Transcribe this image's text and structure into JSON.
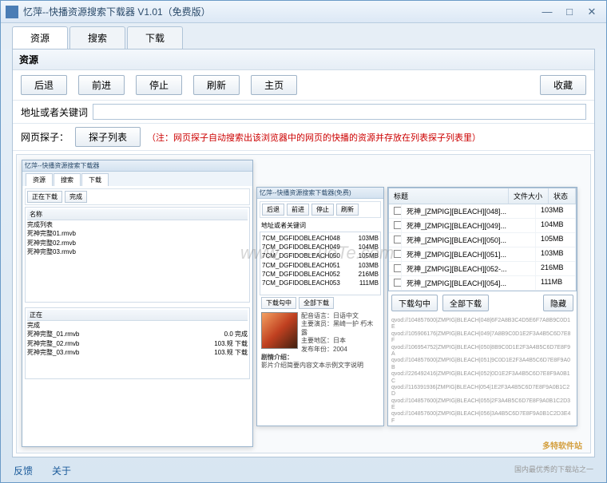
{
  "window": {
    "title": "忆萍--快播资源搜索下载器  V1.01（免费版）"
  },
  "tabs": {
    "resource": "资源",
    "search": "搜索",
    "download": "下载"
  },
  "section": {
    "title": "资源"
  },
  "toolbar": {
    "back": "后退",
    "forward": "前进",
    "stop": "停止",
    "refresh": "刷新",
    "home": "主页",
    "favorites": "收藏"
  },
  "address": {
    "label": "地址或者关键词",
    "value": ""
  },
  "probe": {
    "label": "网页探子：",
    "button": "探子列表",
    "note": "（注：网页探子自动搜索出该浏览器中的网页的快播的资源并存放在列表探子列表里）"
  },
  "download_panel": {
    "headers": {
      "title": "标题",
      "size": "文件大小",
      "status": "状态"
    },
    "rows": [
      {
        "title": "死神_[ZMPIG][BLEACH][048]...",
        "size": "103MB"
      },
      {
        "title": "死神_[ZMPIG][BLEACH][049]...",
        "size": "104MB"
      },
      {
        "title": "死神_[ZMPIG][BLEACH][050]...",
        "size": "105MB"
      },
      {
        "title": "死神_[ZMPIG][BLEACH][051]...",
        "size": "103MB"
      },
      {
        "title": "死神_[ZMPIG][BLEACH][052-...",
        "size": "216MB"
      },
      {
        "title": "死神_[ZMPIG][BLEACH][054]...",
        "size": "111MB"
      }
    ],
    "actions": {
      "download_checked": "下载勾中",
      "download_all": "全部下载",
      "hide": "隐藏"
    }
  },
  "info": {
    "lang": "配音语言：日语中文",
    "cast": "主要演员：黑崎一护 朽木露",
    "region": "主要地区：日本",
    "year": "发布年份：2004",
    "plot_label": "剧情介绍："
  },
  "mini": {
    "left_items": [
      "完成列表",
      "死神完整01.rmvb",
      "死神完整02.rmvb",
      "死神完整03.rmvb"
    ],
    "left_items2": [
      "完成",
      "死神完整_01.rmvb",
      "死神完整_02.rmvb",
      "死神完整_03.rmvb"
    ],
    "mid_links": [
      "7CM_DGFIDOBLEACH048",
      "7CM_DGFIDOBLEACH049",
      "7CM_DGFIDOBLEACH050",
      "7CM_DGFIDOBLEACH051",
      "7CM_DGFIDOBLEACH052",
      "7CM_DGFIDOBLEACH053"
    ],
    "mid_btns": {
      "a": "下载勾中",
      "b": "全部下载"
    }
  },
  "footer": {
    "feedback": "反馈",
    "about": "关于"
  },
  "branding": {
    "watermark": "www.——uoTe.com",
    "logo": "多特软件站",
    "tagline": "国内最优秀的下载站之一"
  }
}
